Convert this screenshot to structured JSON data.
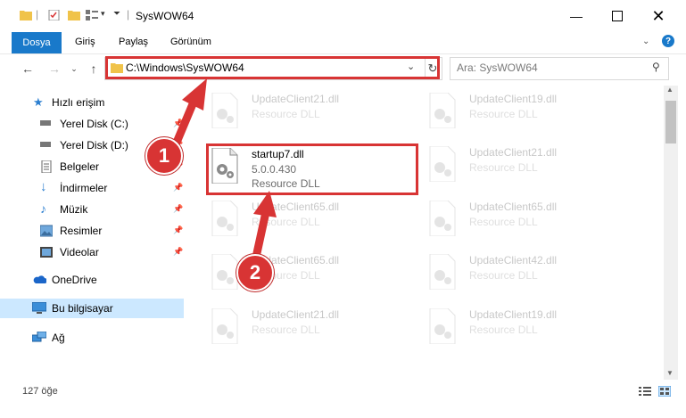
{
  "window": {
    "title": "SysWOW64"
  },
  "ribbon": {
    "tabs": [
      "Dosya",
      "Giriş",
      "Paylaş",
      "Görünüm"
    ]
  },
  "address": {
    "path": "C:\\Windows\\SysWOW64"
  },
  "search": {
    "placeholder": "Ara: SysWOW64"
  },
  "sidebar": {
    "items": [
      {
        "label": "Hızlı erişim",
        "icon": "star-icon"
      },
      {
        "label": "Yerel Disk (C:)",
        "icon": "drive-icon"
      },
      {
        "label": "Yerel Disk (D:)",
        "icon": "drive-icon"
      },
      {
        "label": "Belgeler",
        "icon": "documents-icon"
      },
      {
        "label": "İndirmeler",
        "icon": "download-icon"
      },
      {
        "label": "Müzik",
        "icon": "music-icon"
      },
      {
        "label": "Resimler",
        "icon": "pictures-icon"
      },
      {
        "label": "Videolar",
        "icon": "videos-icon"
      },
      {
        "label": "OneDrive",
        "icon": "cloud-icon"
      },
      {
        "label": "Bu bilgisayar",
        "icon": "computer-icon"
      },
      {
        "label": "Ağ",
        "icon": "network-icon"
      }
    ]
  },
  "files": {
    "col1": [
      {
        "name": "UpdateClient21.dll",
        "type": "Resource DLL"
      },
      {
        "name": "startup7.dll",
        "version": "5.0.0.430",
        "type": "Resource DLL"
      },
      {
        "name": "UpdateClient65.dll",
        "type": "Resource DLL"
      },
      {
        "name": "UpdateClient65.dll",
        "type": "Resource DLL"
      },
      {
        "name": "UpdateClient21.dll",
        "type": "Resource DLL"
      }
    ],
    "col2": [
      {
        "name": "UpdateClient19.dll",
        "type": "Resource DLL"
      },
      {
        "name": "UpdateClient21.dll",
        "type": "Resource DLL"
      },
      {
        "name": "UpdateClient65.dll",
        "type": "Resource DLL"
      },
      {
        "name": "UpdateClient42.dll",
        "type": "Resource DLL"
      },
      {
        "name": "UpdateClient19.dll",
        "type": "Resource DLL"
      }
    ]
  },
  "status": {
    "count": "127 öğe"
  },
  "callouts": [
    "1",
    "2"
  ],
  "colors": {
    "accent": "#1979ca",
    "highlight": "#d83434",
    "selected": "#cce8ff"
  }
}
